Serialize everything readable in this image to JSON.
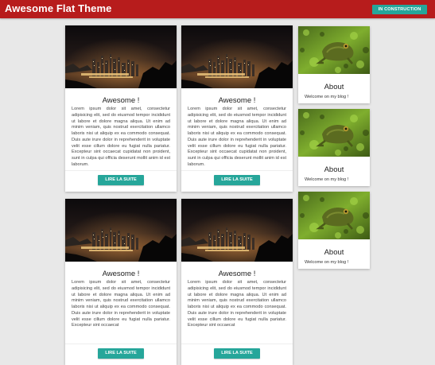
{
  "header": {
    "title": "Awesome Flat Theme",
    "status_button": "IN CONSTRUCTION"
  },
  "posts": [
    {
      "title": "Awesome !",
      "excerpt": "Lorem ipsum dolor sit amet, consectetur adipisicing elit, sed do eiusmod tempor incididunt ut labore et dolore magna aliqua. Ut enim ad minim veniam, quis nostrud exercitation ullamco laboris nisi ut aliquip ex ea commodo consequat. Duis aute irure dolor in reprehenderit in voluptate velit esse cillum dolore eu fugiat nulla pariatur. Excepteur sint occaecat cupidatat non proident, sunt in culpa qui officia deserunt mollit anim id est laborum.",
      "button": "LIRE LA SUITE"
    },
    {
      "title": "Awesome !",
      "excerpt": "Lorem ipsum dolor sit amet, consectetur adipisicing elit, sed do eiusmod tempor incididunt ut labore et dolore magna aliqua. Ut enim ad minim veniam, quis nostrud exercitation ullamco laboris nisi ut aliquip ex ea commodo consequat. Duis aute irure dolor in reprehenderit in voluptate velit esse cillum dolore eu fugiat nulla pariatur. Excepteur sint occaecat cupidatat non proident, sunt in culpa qui officia deserunt mollit anim id est laborum.",
      "button": "LIRE LA SUITE"
    },
    {
      "title": "Awesome !",
      "excerpt": "Lorem ipsum dolor sit amet, consectetur adipisicing elit, sed do eiusmod tempor incididunt ut labore et dolore magna aliqua. Ut enim ad minim veniam, quis nostrud exercitation ullamco laboris nisi ut aliquip ex ea commodo consequat. Duis aute irure dolor in reprehenderit in voluptate velit esse cillum dolore eu fugiat nulla pariatur. Excepteur sint occaecat",
      "button": "LIRE LA SUITE"
    },
    {
      "title": "Awesome !",
      "excerpt": "Lorem ipsum dolor sit amet, consectetur adipisicing elit, sed do eiusmod tempor incididunt ut labore et dolore magna aliqua. Ut enim ad minim veniam, quis nostrud exercitation ullamco laboris nisi ut aliquip ex ea commodo consequat. Duis aute irure dolor in reprehenderit in voluptate velit esse cillum dolore eu fugiat nulla pariatur. Excepteur sint occaecat",
      "button": "LIRE LA SUITE"
    }
  ],
  "sidebar": [
    {
      "title": "About",
      "text": "Welcome on my blog !"
    },
    {
      "title": "About",
      "text": "Welcome on my blog !"
    },
    {
      "title": "About",
      "text": "Welcome on my blog !"
    }
  ],
  "colors": {
    "header": "#b71c1c",
    "accent": "#26a69a",
    "background": "#e8e8e8"
  },
  "icons": {
    "post_image": "city-night-photo",
    "about_image": "frog-on-moss-photo"
  }
}
